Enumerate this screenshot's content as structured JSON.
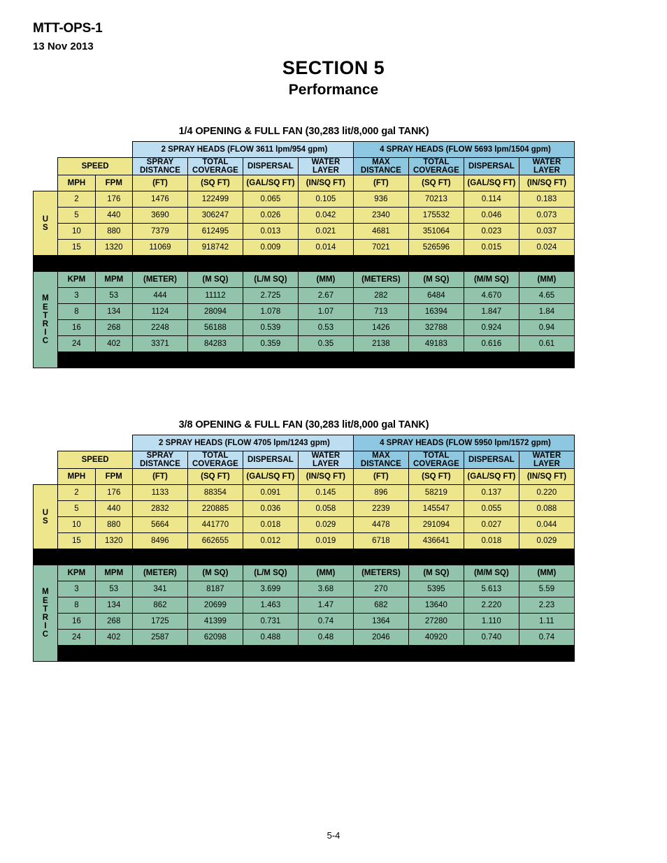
{
  "header": {
    "doc_id": "MTT-OPS-1",
    "date": "13 Nov 2013",
    "section_title": "SECTION 5",
    "section_subtitle": "Performance"
  },
  "footer": {
    "page_number": "5-4"
  },
  "colors": {
    "yellow": "#EDE68C",
    "green": "#92C4AB",
    "blue_light": "#BDDDF0",
    "blue_dark": "#8DC8E0",
    "black": "#000000"
  },
  "common": {
    "speed_label": "SPEED",
    "us_band": "US",
    "metric_band": "METRIC",
    "us_speed_units": [
      "MPH",
      "FPM"
    ],
    "metric_speed_units": [
      "KPM",
      "MPM"
    ],
    "col_titles_left": [
      "SPRAY DISTANCE",
      "TOTAL COVERAGE",
      "DISPERSAL",
      "WATER LAYER"
    ],
    "col_titles_right": [
      "MAX DISTANCE",
      "TOTAL COVERAGE",
      "DISPERSAL",
      "WATER LAYER"
    ],
    "col_title_lines_left": [
      [
        "SPRAY",
        "DISTANCE"
      ],
      [
        "TOTAL",
        "COVERAGE"
      ],
      [
        "DISPERSAL",
        ""
      ],
      [
        "WATER",
        "LAYER"
      ]
    ],
    "col_title_lines_right": [
      [
        "MAX",
        "DISTANCE"
      ],
      [
        "TOTAL",
        "COVERAGE"
      ],
      [
        "DISPERSAL",
        ""
      ],
      [
        "WATER",
        "LAYER"
      ]
    ],
    "us_units": [
      "(FT)",
      "(SQ FT)",
      "(GAL/SQ FT)",
      "(IN/SQ FT)",
      "(FT)",
      "(SQ FT)",
      "(GAL/SQ FT)",
      "(IN/SQ FT)"
    ],
    "metric_units": [
      "(METER)",
      "(M SQ)",
      "(L/M SQ)",
      "(MM)",
      "(METERS)",
      "(M SQ)",
      "(M/M SQ)",
      "(MM)"
    ]
  },
  "tables": [
    {
      "title": "1/4 OPENING & FULL FAN (30,283 lit/8,000 gal TANK)",
      "group_left": "2 SPRAY HEADS (FLOW 3611 lpm/954 gpm)",
      "group_right": "4 SPRAY HEADS (FLOW 5693 lpm/1504 gpm)",
      "us_rows": [
        [
          "2",
          "176",
          "1476",
          "122499",
          "0.065",
          "0.105",
          "936",
          "70213",
          "0.114",
          "0.183"
        ],
        [
          "5",
          "440",
          "3690",
          "306247",
          "0.026",
          "0.042",
          "2340",
          "175532",
          "0.046",
          "0.073"
        ],
        [
          "10",
          "880",
          "7379",
          "612495",
          "0.013",
          "0.021",
          "4681",
          "351064",
          "0.023",
          "0.037"
        ],
        [
          "15",
          "1320",
          "11069",
          "918742",
          "0.009",
          "0.014",
          "7021",
          "526596",
          "0.015",
          "0.024"
        ]
      ],
      "metric_rows": [
        [
          "3",
          "53",
          "444",
          "11112",
          "2.725",
          "2.67",
          "282",
          "6484",
          "4.670",
          "4.65"
        ],
        [
          "8",
          "134",
          "1124",
          "28094",
          "1.078",
          "1.07",
          "713",
          "16394",
          "1.847",
          "1.84"
        ],
        [
          "16",
          "268",
          "2248",
          "56188",
          "0.539",
          "0.53",
          "1426",
          "32788",
          "0.924",
          "0.94"
        ],
        [
          "24",
          "402",
          "3371",
          "84283",
          "0.359",
          "0.35",
          "2138",
          "49183",
          "0.616",
          "0.61"
        ]
      ]
    },
    {
      "title": "3/8 OPENING & FULL FAN (30,283 lit/8,000 gal TANK)",
      "group_left": "2 SPRAY HEADS (FLOW 4705 lpm/1243 gpm)",
      "group_right": "4 SPRAY HEADS (FLOW 5950 lpm/1572 gpm)",
      "us_rows": [
        [
          "2",
          "176",
          "1133",
          "88354",
          "0.091",
          "0.145",
          "896",
          "58219",
          "0.137",
          "0.220"
        ],
        [
          "5",
          "440",
          "2832",
          "220885",
          "0.036",
          "0.058",
          "2239",
          "145547",
          "0.055",
          "0.088"
        ],
        [
          "10",
          "880",
          "5664",
          "441770",
          "0.018",
          "0.029",
          "4478",
          "291094",
          "0.027",
          "0.044"
        ],
        [
          "15",
          "1320",
          "8496",
          "662655",
          "0.012",
          "0.019",
          "6718",
          "436641",
          "0.018",
          "0.029"
        ]
      ],
      "metric_rows": [
        [
          "3",
          "53",
          "341",
          "8187",
          "3.699",
          "3.68",
          "270",
          "5395",
          "5.613",
          "5.59"
        ],
        [
          "8",
          "134",
          "862",
          "20699",
          "1.463",
          "1.47",
          "682",
          "13640",
          "2.220",
          "2.23"
        ],
        [
          "16",
          "268",
          "1725",
          "41399",
          "0.731",
          "0.74",
          "1364",
          "27280",
          "1.110",
          "1.11"
        ],
        [
          "24",
          "402",
          "2587",
          "62098",
          "0.488",
          "0.48",
          "2046",
          "40920",
          "0.740",
          "0.74"
        ]
      ]
    }
  ]
}
